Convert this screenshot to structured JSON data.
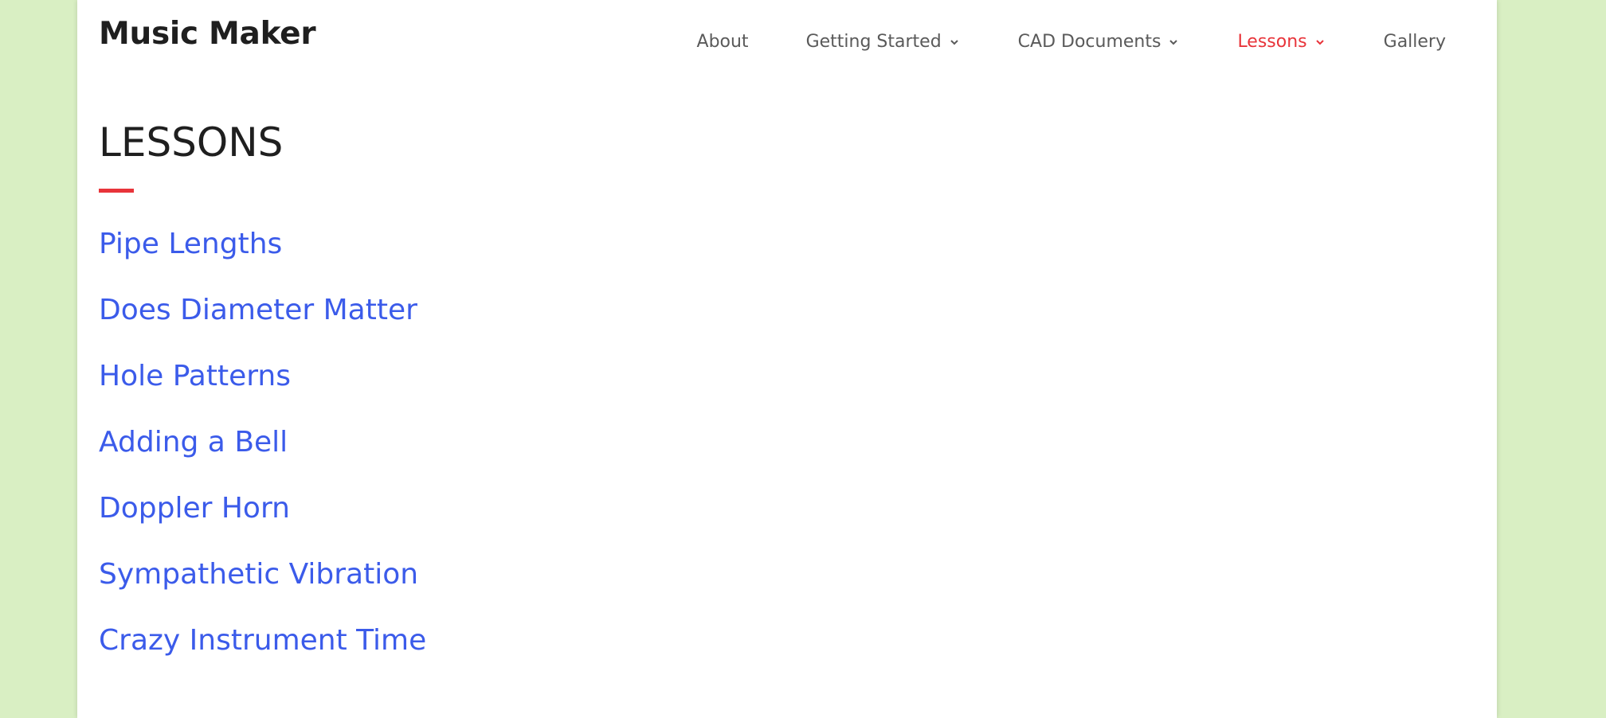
{
  "site": {
    "title": "Music Maker"
  },
  "nav": {
    "items": [
      {
        "label": "About",
        "has_dropdown": false,
        "active": false
      },
      {
        "label": "Getting Started",
        "has_dropdown": true,
        "active": false
      },
      {
        "label": "CAD Documents",
        "has_dropdown": true,
        "active": false
      },
      {
        "label": "Lessons",
        "has_dropdown": true,
        "active": true
      },
      {
        "label": "Gallery",
        "has_dropdown": false,
        "active": false
      }
    ]
  },
  "main": {
    "heading": "LESSONS",
    "lessons": [
      {
        "label": "Pipe Lengths"
      },
      {
        "label": "Does Diameter Matter"
      },
      {
        "label": "Hole Patterns"
      },
      {
        "label": "Adding a Bell"
      },
      {
        "label": "Doppler Horn"
      },
      {
        "label": "Sympathetic Vibration"
      },
      {
        "label": "Crazy Instrument Time"
      }
    ]
  },
  "colors": {
    "page_background": "#d9efc3",
    "content_background": "#ffffff",
    "accent": "#e8343a",
    "link": "#3b5bea",
    "nav_text": "#5a5a5a",
    "heading_text": "#1f1f1f"
  },
  "icons": {
    "dropdown": "chevron-down-icon"
  }
}
